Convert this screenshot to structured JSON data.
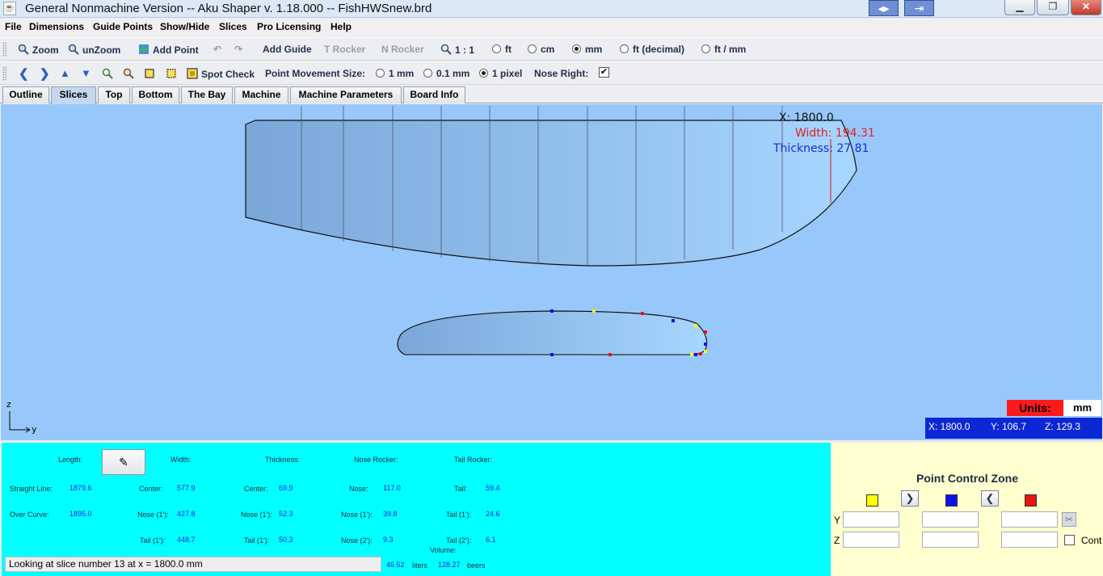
{
  "window": {
    "title": "General Nonmachine Version -- Aku Shaper v. 1.18.000  --  FishHWSnew.brd",
    "minimize_glyph": "▁",
    "maximize_glyph": "❐",
    "close_glyph": "✕"
  },
  "menu": [
    "File",
    "Dimensions",
    "Guide Points",
    "Show/Hide",
    "Slices",
    "Pro Licensing",
    "Help"
  ],
  "toolbar1": {
    "zoom": "Zoom",
    "unzoom": "unZoom",
    "add_point": "Add Point",
    "add_guide": "Add Guide",
    "t_rocker": "T Rocker",
    "n_rocker": "N Rocker",
    "scale": "1 : 1",
    "units": [
      {
        "label": "ft",
        "selected": false
      },
      {
        "label": "cm",
        "selected": false
      },
      {
        "label": "mm",
        "selected": true
      },
      {
        "label": "ft (decimal)",
        "selected": false
      },
      {
        "label": "ft / mm",
        "selected": false
      }
    ]
  },
  "toolbar2": {
    "spot_check": "Spot Check",
    "point_movement_label": "Point Movement Size:",
    "movement_options": [
      {
        "label": "1 mm",
        "selected": false
      },
      {
        "label": "0.1 mm",
        "selected": false
      },
      {
        "label": "1 pixel",
        "selected": true
      }
    ],
    "nose_right_label": "Nose Right:",
    "nose_right_checked": "✔"
  },
  "tabs": [
    {
      "label": "Outline",
      "active": false
    },
    {
      "label": "Slices",
      "active": true
    },
    {
      "label": "Top",
      "active": false
    },
    {
      "label": "Bottom",
      "active": false
    },
    {
      "label": "The Bay",
      "active": false
    },
    {
      "label": "Machine",
      "active": false
    },
    {
      "label": "Machine Parameters",
      "active": false
    },
    {
      "label": "Board Info",
      "active": false
    }
  ],
  "canvas": {
    "x_readout": "X: 1800.0",
    "width_readout": "Width: 194.31",
    "thickness_readout": "Thickness: 27.81",
    "axis_z": "z",
    "axis_y": "y",
    "units_label": "Units:",
    "units_value": "mm",
    "coord_x": "X: 1800.0",
    "coord_y": "Y: 106.7",
    "coord_z": "Z: 129.3",
    "colors": {
      "background": "#98c8fb",
      "width_text": "#e02020",
      "thickness_text": "#1a2fd0",
      "point_yellow": "#ffff00",
      "point_red": "#ee1111",
      "point_blue": "#1010ee"
    }
  },
  "info": {
    "headers": {
      "length": "Length:",
      "width": "Width:",
      "thickness": "Thickness:",
      "nose_rocker": "Nose Rocker:",
      "tail_rocker": "Tail Rocker:"
    },
    "length": {
      "straight_line_label": "Straight Line:",
      "straight_line": "1879.6",
      "over_curve_label": "Over Curve:",
      "over_curve": "1895.0"
    },
    "width": {
      "center_label": "Center:",
      "center": "577.9",
      "nose_label": "Nose (1'):",
      "nose": "427.8",
      "tail_label": "Tail (1'):",
      "tail": "448.7"
    },
    "thickness": {
      "center_label": "Center:",
      "center": "69.9",
      "nose_label": "Nose (1'):",
      "nose": "52.3",
      "tail_label": "Tail (1'):",
      "tail": "50.3"
    },
    "nose_rocker": {
      "nose_label": "Nose:",
      "nose": "117.0",
      "nose1_label": "Nose (1'):",
      "nose1": "39.8",
      "nose2_label": "Nose (2'):",
      "nose2": "9.3"
    },
    "tail_rocker": {
      "tail_label": "Tail:",
      "tail": "59.4",
      "tail1_label": "Tail (1'):",
      "tail1": "24.6",
      "tail2_label": "Tail (2'):",
      "tail2": "6.1"
    },
    "volume_label": "Volume:",
    "volume_liters": "46.52",
    "liters_label": "liters",
    "volume_beers": "128.27",
    "beers_label": "beers",
    "status": "Looking at slice number 13 at x = 1800.0 mm"
  },
  "point_control": {
    "title": "Point Control Zone",
    "y_label": "Y",
    "z_label": "Z",
    "cont_label": "Cont",
    "swatches": [
      "#ffff00",
      "#1010ee",
      "#ee1111"
    ],
    "next_glyph": "❯",
    "prev_glyph": "❮"
  }
}
